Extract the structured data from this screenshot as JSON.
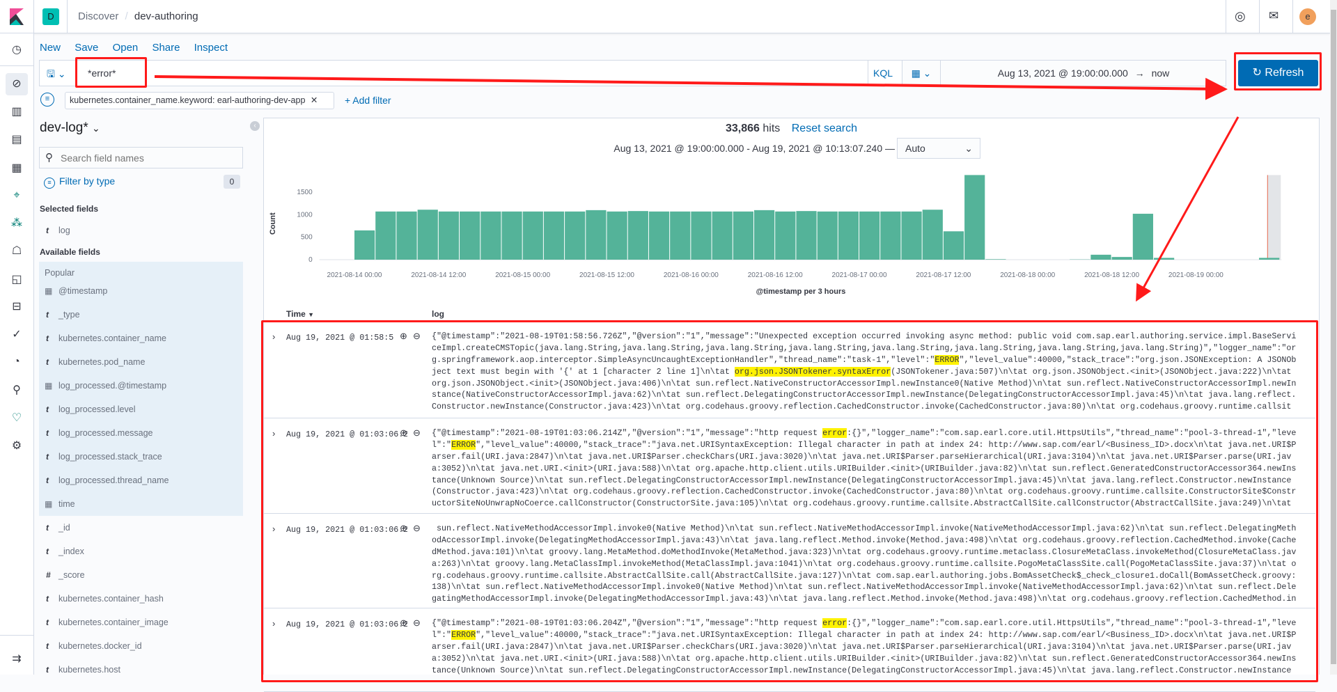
{
  "header": {
    "space_badge": "D",
    "breadcrumbs": [
      "Discover",
      "dev-authoring"
    ],
    "avatar": "e",
    "icons": [
      "help-icon",
      "mail-icon"
    ]
  },
  "nav": {
    "icons": [
      "clock-icon",
      "discover-icon",
      "visualize-icon",
      "dashboard-icon",
      "canvas-icon",
      "maps-icon",
      "ml-icon",
      "metrics-icon",
      "logs-icon",
      "apm-icon",
      "uptime-icon",
      "siem-icon",
      "dev-tools-icon",
      "monitoring-icon",
      "management-icon"
    ],
    "collapse": "collapse-nav-icon"
  },
  "menu": {
    "items": [
      "New",
      "Save",
      "Open",
      "Share",
      "Inspect"
    ]
  },
  "query": {
    "value": "*error*",
    "language": "KQL",
    "date_start": "Aug 13, 2021 @ 19:00:00.000",
    "arrow": "→",
    "date_end": "now",
    "refresh_label": "Refresh"
  },
  "filters": {
    "pill": "kubernetes.container_name.keyword: earl-authoring-dev-app",
    "add": "+ Add filter"
  },
  "sidebar": {
    "index_pattern": "dev-log*",
    "search_placeholder": "Search field names",
    "filter_by_type": "Filter by type",
    "filter_count": "0",
    "selected_title": "Selected fields",
    "selected": [
      {
        "type": "t",
        "name": "log"
      }
    ],
    "available_title": "Available fields",
    "popular_title": "Popular",
    "popular": [
      {
        "type": "date",
        "name": "@timestamp"
      },
      {
        "type": "t",
        "name": "_type"
      },
      {
        "type": "t",
        "name": "kubernetes.container_name"
      },
      {
        "type": "t",
        "name": "kubernetes.pod_name"
      },
      {
        "type": "date",
        "name": "log_processed.@timestamp"
      },
      {
        "type": "t",
        "name": "log_processed.level"
      },
      {
        "type": "t",
        "name": "log_processed.message"
      },
      {
        "type": "t",
        "name": "log_processed.stack_trace"
      },
      {
        "type": "t",
        "name": "log_processed.thread_name"
      },
      {
        "type": "date",
        "name": "time"
      }
    ],
    "other": [
      {
        "type": "t",
        "name": "_id"
      },
      {
        "type": "t",
        "name": "_index"
      },
      {
        "type": "#",
        "name": "_score"
      },
      {
        "type": "t",
        "name": "kubernetes.container_hash"
      },
      {
        "type": "t",
        "name": "kubernetes.container_image"
      },
      {
        "type": "t",
        "name": "kubernetes.docker_id"
      },
      {
        "type": "t",
        "name": "kubernetes.host"
      }
    ]
  },
  "results": {
    "hits": "33,866",
    "hits_label": "hits",
    "reset": "Reset search",
    "range": "Aug 13, 2021 @ 19:00:00.000 - Aug 19, 2021 @ 10:13:07.240 —",
    "interval": "Auto"
  },
  "chart_data": {
    "type": "bar",
    "color": "#54b399",
    "xlabel": "@timestamp per 3 hours",
    "ylabel": "Count",
    "xlim": [
      "2021-08-13 19:00",
      "2021-08-19 10:13"
    ],
    "ylim": [
      0,
      1880
    ],
    "yticks": [
      0,
      500,
      1000,
      1500
    ],
    "xticks": [
      "2021-08-14 00:00",
      "2021-08-14 12:00",
      "2021-08-15 00:00",
      "2021-08-15 12:00",
      "2021-08-16 00:00",
      "2021-08-16 12:00",
      "2021-08-17 00:00",
      "2021-08-17 12:00",
      "2021-08-18 00:00",
      "2021-08-18 12:00",
      "2021-08-19 00:00"
    ],
    "bucket_start": "2021-08-14 00:00",
    "bucket_hours": 3,
    "values": [
      650,
      1070,
      1070,
      1110,
      1070,
      1070,
      1070,
      1070,
      1070,
      1070,
      1070,
      1100,
      1070,
      1080,
      1070,
      1070,
      1070,
      1070,
      1070,
      1100,
      1070,
      1080,
      1070,
      1070,
      1070,
      1070,
      1070,
      1110,
      630,
      1880,
      10,
      0,
      0,
      0,
      5,
      110,
      60,
      1020,
      40,
      0,
      0,
      0,
      0,
      40
    ],
    "grid": false
  },
  "table": {
    "columns": [
      "Time",
      "log"
    ],
    "rows": [
      {
        "time": "Aug 19, 2021 @ 01:58:5",
        "highlights": [
          "ERROR",
          "org.json.JSONTokener.syntaxError"
        ],
        "lines": [
          "{\"@timestamp\":\"2021-08-19T01:58:56.726Z\",\"@version\":\"1\",\"message\":\"Unexpected exception occurred invoking async method: public void com.sap.earl.authoring.service.impl.BaseServi",
          "ceImpl.createCMSTopic(java.lang.String,java.lang.String,java.lang.String,java.lang.String,java.lang.String,java.lang.String,java.lang.String,java.lang.String)\",\"logger_name\":\"or",
          "g.springframework.aop.interceptor.SimpleAsyncUncaughtExceptionHandler\",\"thread_name\":\"task-1\",\"level\":\"ERROR\",\"level_value\":40000,\"stack_trace\":\"org.json.JSONException: A JSONOb",
          "ject text must begin with '{' at 1 [character 2 line 1]\\n\\tat org.json.JSONTokener.syntaxError(JSONTokener.java:507)\\n\\tat org.json.JSONObject.<init>(JSONObject.java:222)\\n\\tat",
          "org.json.JSONObject.<init>(JSONObject.java:406)\\n\\tat sun.reflect.NativeConstructorAccessorImpl.newInstance0(Native Method)\\n\\tat sun.reflect.NativeConstructorAccessorImpl.newIn",
          "stance(NativeConstructorAccessorImpl.java:62)\\n\\tat sun.reflect.DelegatingConstructorAccessorImpl.newInstance(DelegatingConstructorAccessorImpl.java:45)\\n\\tat java.lang.reflect.",
          "Constructor.newInstance(Constructor.java:423)\\n\\tat org.codehaus.groovy.reflection.CachedConstructor.invoke(CachedConstructor.java:80)\\n\\tat org.codehaus.groovy.runtime.callsit"
        ]
      },
      {
        "time": "Aug 19, 2021 @ 01:03:06.215",
        "highlights": [
          "error",
          "ERROR"
        ],
        "lines": [
          "{\"@timestamp\":\"2021-08-19T01:03:06.214Z\",\"@version\":\"1\",\"message\":\"http request error:{}\",\"logger_name\":\"com.sap.earl.core.util.HttpsUtils\",\"thread_name\":\"pool-3-thread-1\",\"leve",
          "l\":\"ERROR\",\"level_value\":40000,\"stack_trace\":\"java.net.URISyntaxException: Illegal character in path at index 24: http://www.sap.com/earl/<Business_ID>.docx\\n\\tat java.net.URI$P",
          "arser.fail(URI.java:2847)\\n\\tat java.net.URI$Parser.checkChars(URI.java:3020)\\n\\tat java.net.URI$Parser.parseHierarchical(URI.java:3104)\\n\\tat java.net.URI$Parser.parse(URI.jav",
          "a:3052)\\n\\tat java.net.URI.<init>(URI.java:588)\\n\\tat org.apache.http.client.utils.URIBuilder.<init>(URIBuilder.java:82)\\n\\tat sun.reflect.GeneratedConstructorAccessor364.newIns",
          "tance(Unknown Source)\\n\\tat sun.reflect.DelegatingConstructorAccessorImpl.newInstance(DelegatingConstructorAccessorImpl.java:45)\\n\\tat java.lang.reflect.Constructor.newInstance",
          "(Constructor.java:423)\\n\\tat org.codehaus.groovy.reflection.CachedConstructor.invoke(CachedConstructor.java:80)\\n\\tat org.codehaus.groovy.runtime.callsite.ConstructorSite$Constr",
          "uctorSiteNoUnwrapNoCoerce.callConstructor(ConstructorSite.java:105)\\n\\tat org.codehaus.groovy.runtime.callsite.AbstractCallSite.callConstructor(AbstractCallSite.java:249)\\n\\tat"
        ]
      },
      {
        "time": "Aug 19, 2021 @ 01:03:06.215",
        "highlights": [],
        "lines": [
          " sun.reflect.NativeMethodAccessorImpl.invoke0(Native Method)\\n\\tat sun.reflect.NativeMethodAccessorImpl.invoke(NativeMethodAccessorImpl.java:62)\\n\\tat sun.reflect.DelegatingMeth",
          "odAccessorImpl.invoke(DelegatingMethodAccessorImpl.java:43)\\n\\tat java.lang.reflect.Method.invoke(Method.java:498)\\n\\tat org.codehaus.groovy.reflection.CachedMethod.invoke(Cache",
          "dMethod.java:101)\\n\\tat groovy.lang.MetaMethod.doMethodInvoke(MetaMethod.java:323)\\n\\tat org.codehaus.groovy.runtime.metaclass.ClosureMetaClass.invokeMethod(ClosureMetaClass.jav",
          "a:263)\\n\\tat groovy.lang.MetaClassImpl.invokeMethod(MetaClassImpl.java:1041)\\n\\tat org.codehaus.groovy.runtime.callsite.PogoMetaClassSite.call(PogoMetaClassSite.java:37)\\n\\tat o",
          "rg.codehaus.groovy.runtime.callsite.AbstractCallSite.call(AbstractCallSite.java:127)\\n\\tat com.sap.earl.authoring.jobs.BomAssetCheck$_check_closure1.doCall(BomAssetCheck.groovy:",
          "138)\\n\\tat sun.reflect.NativeMethodAccessorImpl.invoke0(Native Method)\\n\\tat sun.reflect.NativeMethodAccessorImpl.invoke(NativeMethodAccessorImpl.java:62)\\n\\tat sun.reflect.Dele",
          "gatingMethodAccessorImpl.invoke(DelegatingMethodAccessorImpl.java:43)\\n\\tat java.lang.reflect.Method.invoke(Method.java:498)\\n\\tat org.codehaus.groovy.reflection.CachedMethod.in"
        ]
      },
      {
        "time": "Aug 19, 2021 @ 01:03:06.205",
        "highlights": [
          "error",
          "ERROR"
        ],
        "lines": [
          "{\"@timestamp\":\"2021-08-19T01:03:06.204Z\",\"@version\":\"1\",\"message\":\"http request error:{}\",\"logger_name\":\"com.sap.earl.core.util.HttpsUtils\",\"thread_name\":\"pool-3-thread-1\",\"leve",
          "l\":\"ERROR\",\"level_value\":40000,\"stack_trace\":\"java.net.URISyntaxException: Illegal character in path at index 24: http://www.sap.com/earl/<Business_ID>.docx\\n\\tat java.net.URI$P",
          "arser.fail(URI.java:2847)\\n\\tat java.net.URI$Parser.checkChars(URI.java:3020)\\n\\tat java.net.URI$Parser.parseHierarchical(URI.java:3104)\\n\\tat java.net.URI$Parser.parse(URI.jav",
          "a:3052)\\n\\tat java.net.URI.<init>(URI.java:588)\\n\\tat org.apache.http.client.utils.URIBuilder.<init>(URIBuilder.java:82)\\n\\tat sun.reflect.GeneratedConstructorAccessor364.newIns",
          "tance(Unknown Source)\\n\\tat sun.reflect.DelegatingConstructorAccessorImpl.newInstance(DelegatingConstructorAccessorImpl.java:45)\\n\\tat java.lang.reflect.Constructor.newInstance"
        ]
      }
    ]
  },
  "colors": {
    "accent": "#006bb4",
    "bar": "#54b399",
    "highlight": "#fff200",
    "annotation": "#ff1a1a",
    "avatar": "#f1a05c",
    "space": "#00bfb3"
  }
}
